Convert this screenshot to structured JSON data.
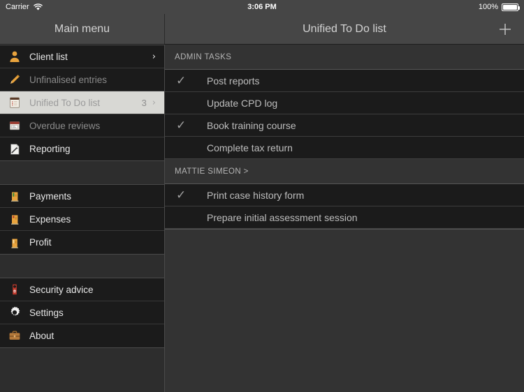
{
  "statusbar": {
    "carrier": "Carrier",
    "wifi_icon": "wifi-icon",
    "time": "3:06 PM",
    "battery_pct": "100%",
    "battery_icon": "battery-icon"
  },
  "navbar": {
    "left_title": "Main menu",
    "right_title": "Unified To Do list",
    "add_icon": "plus-icon"
  },
  "sidebar": {
    "groups": [
      {
        "items": [
          {
            "label": "Client list",
            "icon": "person-icon",
            "dim": false,
            "badge": "",
            "chevron": "›",
            "selected": false
          },
          {
            "label": "Unfinalised entries",
            "icon": "pencil-icon",
            "dim": true,
            "badge": "",
            "chevron": "",
            "selected": false
          },
          {
            "label": "Unified To Do list",
            "icon": "notepad-icon",
            "dim": false,
            "badge": "3",
            "chevron": "›",
            "selected": true
          },
          {
            "label": "Overdue reviews",
            "icon": "calendar-icon",
            "dim": true,
            "badge": "",
            "chevron": "",
            "selected": false
          },
          {
            "label": "Reporting",
            "icon": "report-document-icon",
            "dim": false,
            "badge": "",
            "chevron": "",
            "selected": false
          }
        ]
      },
      {
        "items": [
          {
            "label": "Payments",
            "icon": "bar-chart-green-icon",
            "dim": false,
            "badge": "",
            "chevron": "",
            "selected": false
          },
          {
            "label": "Expenses",
            "icon": "bar-chart-red-icon",
            "dim": false,
            "badge": "",
            "chevron": "",
            "selected": false
          },
          {
            "label": "Profit",
            "icon": "bar-chart-gold-icon",
            "dim": false,
            "badge": "",
            "chevron": "",
            "selected": false
          }
        ]
      },
      {
        "items": [
          {
            "label": "Security advice",
            "icon": "door-hanger-icon",
            "dim": false,
            "badge": "",
            "chevron": "",
            "selected": false
          },
          {
            "label": "Settings",
            "icon": "gear-icon",
            "dim": false,
            "badge": "",
            "chevron": "",
            "selected": false
          },
          {
            "label": "About",
            "icon": "briefcase-icon",
            "dim": false,
            "badge": "",
            "chevron": "",
            "selected": false
          }
        ]
      }
    ]
  },
  "main": {
    "sections": [
      {
        "title": "ADMIN TASKS",
        "tasks": [
          {
            "label": "Post reports",
            "checked": true
          },
          {
            "label": "Update CPD log",
            "checked": false
          },
          {
            "label": "Book training course",
            "checked": true
          },
          {
            "label": "Complete tax return",
            "checked": false
          }
        ]
      },
      {
        "title": "MATTIE SIMEON >",
        "tasks": [
          {
            "label": "Print case history form",
            "checked": true
          },
          {
            "label": "Prepare initial assessment session",
            "checked": false
          }
        ]
      }
    ],
    "check_glyph": "✓"
  },
  "colors": {
    "sidebar_bg": "#2d2d2d",
    "row_bg": "#1b1b1b",
    "selected_bg": "#d8d8d4",
    "content_bg": "#333333",
    "navbar_bg": "#464646",
    "accent_gold": "#e8a33d"
  }
}
